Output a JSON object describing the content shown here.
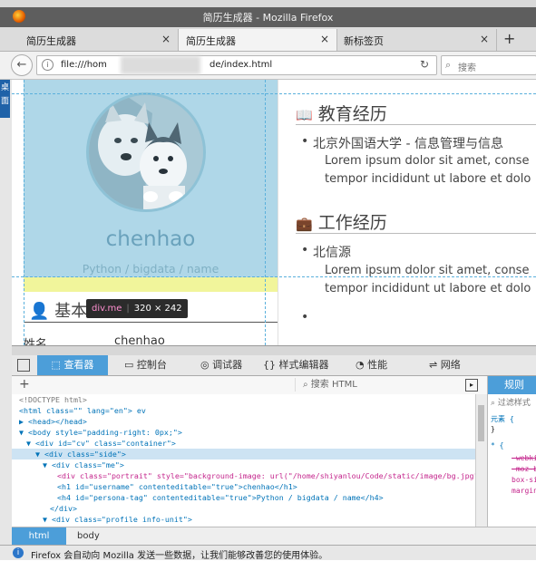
{
  "window": {
    "title": "简历生成器 - Mozilla Firefox"
  },
  "tabs": [
    {
      "label": "简历生成器"
    },
    {
      "label": "简历生成器"
    },
    {
      "label": "新标签页"
    }
  ],
  "tab_close": "×",
  "new_tab": "+",
  "nav": {
    "back_icon": "←",
    "url_left": "file:///hom",
    "url_right": "de/index.html",
    "reload_icon": "↻",
    "search_placeholder": "搜索"
  },
  "left_strip": {
    "label": "隐藏桌面"
  },
  "resume": {
    "name": "chenhao",
    "tag": "Python / bigdata / name",
    "basic_title": "基本信",
    "basic_row_key": "姓名",
    "basic_row_val": "chenhao",
    "education_title": "教育经历",
    "education_item": "北京外国语大学 - 信息管理与信息",
    "work_title": "工作经历",
    "work_item": "北信源",
    "lorem_line1": "Lorem ipsum dolor sit amet, conse",
    "lorem_line2": "tempor incididunt ut labore et dolo",
    "bullet": "•"
  },
  "tooltip": {
    "selector": "div.me",
    "size": "320 × 242"
  },
  "devtools": {
    "tabs": [
      "查看器",
      "控制台",
      "调试器",
      "样式编辑器",
      "性能",
      "网络"
    ],
    "search_placeholder": "搜索 HTML",
    "markup": [
      "<!DOCTYPE html>",
      "<html class=\"\" lang=\"en\"> ev",
      "▶ <head></head>",
      "▼ <body style=\"padding-right: 0px;\">",
      "▼ <div id=\"cv\" class=\"container\">",
      "▼ <div class=\"side\">",
      "▼ <div class=\"me\">",
      "<div class=\"portrait\" style=\"background-image: url(\"/home/shiyanlou/Code/static/image/bg.jpg\");\"></div>",
      "<h1 id=\"username\" contenteditable=\"true\">chenhao</h1>",
      "<h4 id=\"persona-tag\" contenteditable=\"true\">Python / bigdata / name</h4>",
      "</div>",
      "▼ <div class=\"profile info-unit\">"
    ],
    "rules_tab": "规则",
    "rules_filter": "过滤样式",
    "rules": [
      "元素 {",
      "}",
      "* {",
      "-webkit",
      "-moz-b",
      "box-si",
      "margin"
    ],
    "breadcrumbs": [
      "html",
      "body"
    ]
  },
  "notification": "Firefox 会自动向 Mozilla 发送一些数据，让我们能够改善您的使用体验。"
}
